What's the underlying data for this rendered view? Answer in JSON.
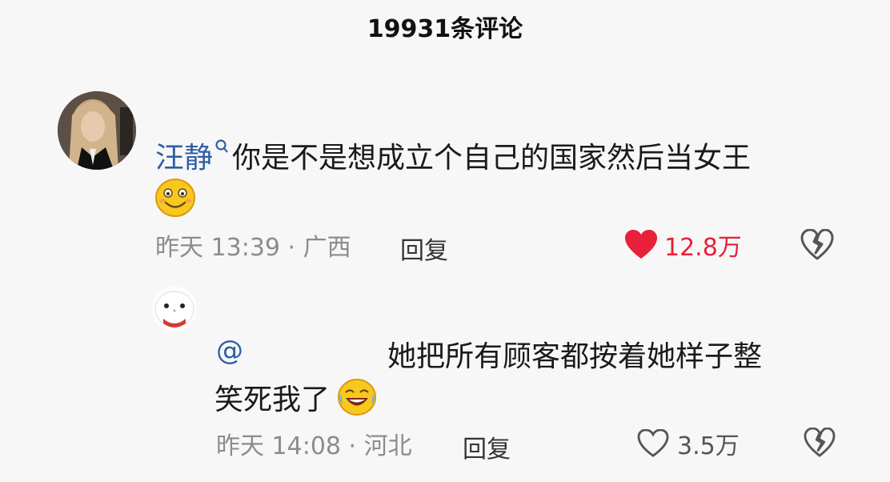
{
  "header": {
    "title": "19931条评论"
  },
  "comment": {
    "username": "汪静",
    "text": "你是不是想成立个自己的国家然后当女王",
    "time_location": "昨天 13:39 · 广西",
    "reply_label": "回复",
    "likes": "12.8万",
    "like_color": "#e8203a"
  },
  "reply": {
    "at": "@",
    "text_line1": "她把所有顾客都按着她样子整",
    "text_line2": "笑死我了",
    "time_location": "昨天 14:08 · 河北",
    "reply_label": "回复",
    "likes": "3.5万"
  },
  "colors": {
    "username": "#2e5fa3",
    "meta": "#8c8c8c",
    "background": "#f7f7f7"
  }
}
